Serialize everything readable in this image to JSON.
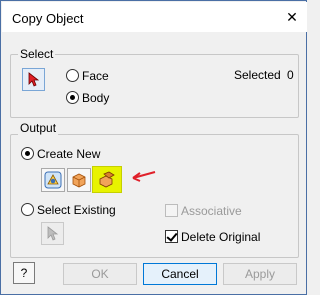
{
  "dialog": {
    "title": "Copy Object",
    "close_label": "✕"
  },
  "select_group": {
    "legend": "Select",
    "face_label": "Face",
    "body_label": "Body",
    "selected_text": "Selected",
    "selected_count": "0",
    "selected_option": "Body"
  },
  "output_group": {
    "legend": "Output",
    "create_new_label": "Create New",
    "select_existing_label": "Select Existing",
    "associative_label": "Associative",
    "delete_original_label": "Delete Original",
    "selected_option": "Create New",
    "create_new_buttons": [
      {
        "icon": "surface-body-icon",
        "highlighted": false
      },
      {
        "icon": "solid-body-icon",
        "highlighted": false
      },
      {
        "icon": "composite-body-icon",
        "highlighted": true
      }
    ],
    "associative_checked": false,
    "delete_original_checked": true
  },
  "footer": {
    "ok_label": "OK",
    "cancel_label": "Cancel",
    "apply_label": "Apply",
    "help_label": "?"
  },
  "annotation": {
    "arrow_color": "#e0202a",
    "highlight_color": "#e8f300"
  }
}
